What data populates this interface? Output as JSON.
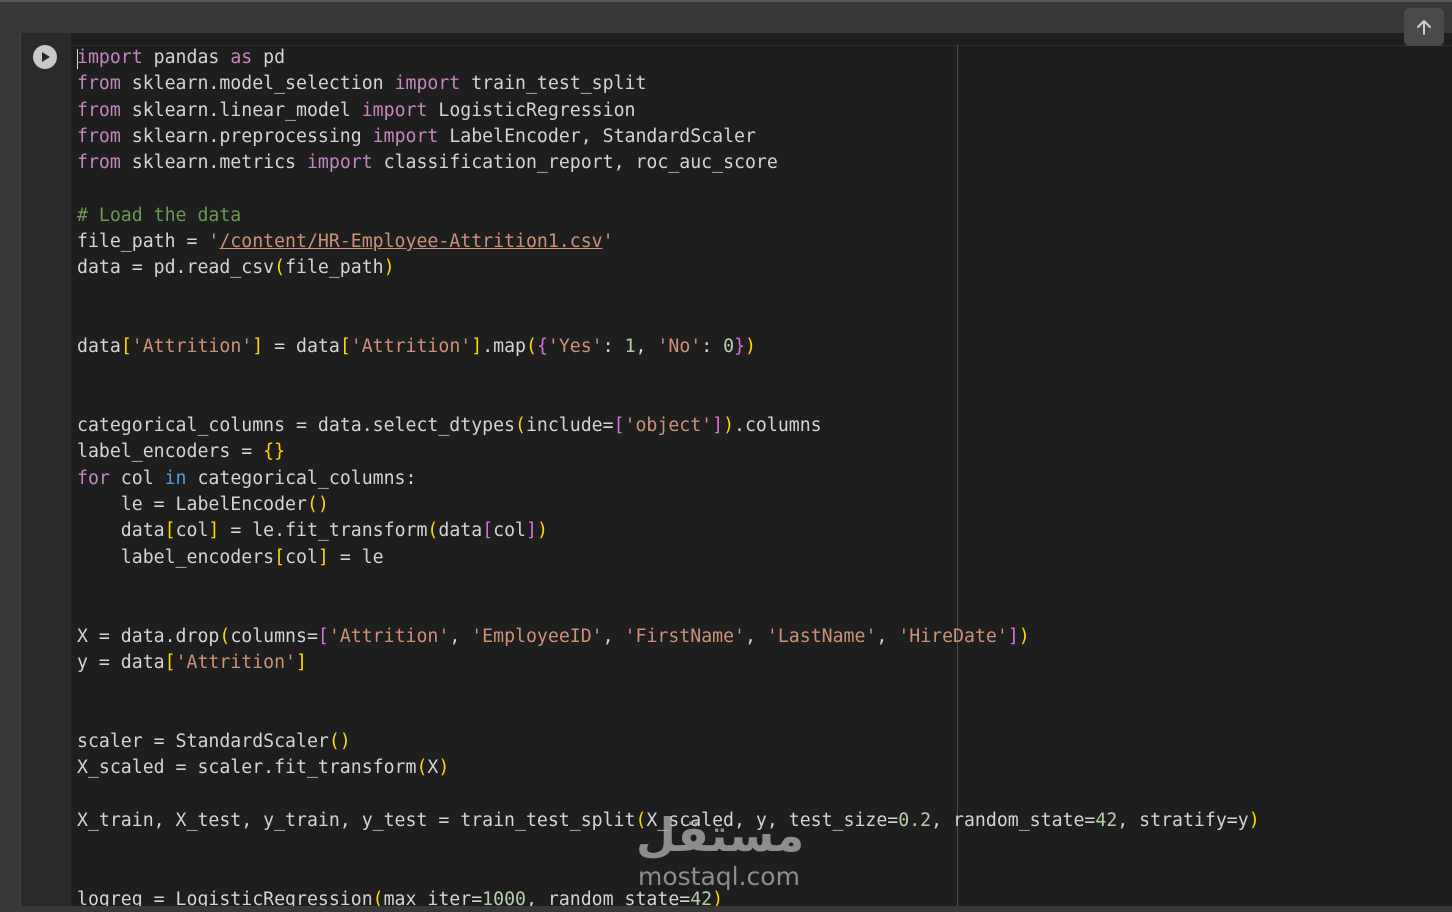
{
  "toolbar": {
    "scroll_up_icon": "arrow-up-icon"
  },
  "cell": {
    "run_icon": "play-icon",
    "lines": [
      [
        [
          "k",
          "import"
        ],
        [
          "t",
          " pandas "
        ],
        [
          "k",
          "as"
        ],
        [
          "t",
          " pd"
        ]
      ],
      [
        [
          "k",
          "from"
        ],
        [
          "t",
          " sklearn.model_selection "
        ],
        [
          "k",
          "import"
        ],
        [
          "t",
          " train_test_split"
        ]
      ],
      [
        [
          "k",
          "from"
        ],
        [
          "t",
          " sklearn.linear_model "
        ],
        [
          "k",
          "import"
        ],
        [
          "t",
          " LogisticRegression"
        ]
      ],
      [
        [
          "k",
          "from"
        ],
        [
          "t",
          " sklearn.preprocessing "
        ],
        [
          "k",
          "import"
        ],
        [
          "t",
          " LabelEncoder, StandardScaler"
        ]
      ],
      [
        [
          "k",
          "from"
        ],
        [
          "t",
          " sklearn.metrics "
        ],
        [
          "k",
          "import"
        ],
        [
          "t",
          " classification_report, roc_auc_score"
        ]
      ],
      [],
      [
        [
          "c",
          "# Load the data"
        ]
      ],
      [
        [
          "t",
          "file_path = "
        ],
        [
          "s",
          "'"
        ],
        [
          "su",
          "/content/HR-Employee-Attrition1.csv"
        ],
        [
          "s",
          "'"
        ]
      ],
      [
        [
          "t",
          "data = pd.read_csv"
        ],
        [
          "b1",
          "("
        ],
        [
          "t",
          "file_path"
        ],
        [
          "b1",
          ")"
        ]
      ],
      [],
      [],
      [
        [
          "t",
          "data"
        ],
        [
          "b1",
          "["
        ],
        [
          "s",
          "'Attrition'"
        ],
        [
          "b1",
          "]"
        ],
        [
          "t",
          " = data"
        ],
        [
          "b1",
          "["
        ],
        [
          "s",
          "'Attrition'"
        ],
        [
          "b1",
          "]"
        ],
        [
          "t",
          ".map"
        ],
        [
          "b1",
          "("
        ],
        [
          "b2",
          "{"
        ],
        [
          "s",
          "'Yes'"
        ],
        [
          "t",
          ": "
        ],
        [
          "n",
          "1"
        ],
        [
          "t",
          ", "
        ],
        [
          "s",
          "'No'"
        ],
        [
          "t",
          ": "
        ],
        [
          "n",
          "0"
        ],
        [
          "b2",
          "}"
        ],
        [
          "b1",
          ")"
        ]
      ],
      [],
      [],
      [
        [
          "t",
          "categorical_columns = data.select_dtypes"
        ],
        [
          "b1",
          "("
        ],
        [
          "t",
          "include="
        ],
        [
          "b2",
          "["
        ],
        [
          "s",
          "'object'"
        ],
        [
          "b2",
          "]"
        ],
        [
          "b1",
          ")"
        ],
        [
          "t",
          ".columns"
        ]
      ],
      [
        [
          "t",
          "label_encoders = "
        ],
        [
          "b1",
          "{}"
        ]
      ],
      [
        [
          "k",
          "for"
        ],
        [
          "t",
          " col "
        ],
        [
          "kw",
          "in"
        ],
        [
          "t",
          " categorical_columns:"
        ]
      ],
      [
        [
          "t",
          "    le = LabelEncoder"
        ],
        [
          "b1",
          "()"
        ]
      ],
      [
        [
          "t",
          "    data"
        ],
        [
          "b1",
          "["
        ],
        [
          "t",
          "col"
        ],
        [
          "b1",
          "]"
        ],
        [
          "t",
          " = le.fit_transform"
        ],
        [
          "b1",
          "("
        ],
        [
          "t",
          "data"
        ],
        [
          "b2",
          "["
        ],
        [
          "t",
          "col"
        ],
        [
          "b2",
          "]"
        ],
        [
          "b1",
          ")"
        ]
      ],
      [
        [
          "t",
          "    label_encoders"
        ],
        [
          "b1",
          "["
        ],
        [
          "t",
          "col"
        ],
        [
          "b1",
          "]"
        ],
        [
          "t",
          " = le"
        ]
      ],
      [],
      [],
      [
        [
          "t",
          "X = data.drop"
        ],
        [
          "b1",
          "("
        ],
        [
          "t",
          "columns="
        ],
        [
          "b2",
          "["
        ],
        [
          "s",
          "'Attrition'"
        ],
        [
          "t",
          ", "
        ],
        [
          "s",
          "'EmployeeID'"
        ],
        [
          "t",
          ", "
        ],
        [
          "s",
          "'FirstName'"
        ],
        [
          "t",
          ", "
        ],
        [
          "s",
          "'LastName'"
        ],
        [
          "t",
          ", "
        ],
        [
          "s",
          "'HireDate'"
        ],
        [
          "b2",
          "]"
        ],
        [
          "b1",
          ")"
        ]
      ],
      [
        [
          "t",
          "y = data"
        ],
        [
          "b1",
          "["
        ],
        [
          "s",
          "'Attrition'"
        ],
        [
          "b1",
          "]"
        ]
      ],
      [],
      [],
      [
        [
          "t",
          "scaler = StandardScaler"
        ],
        [
          "b1",
          "()"
        ]
      ],
      [
        [
          "t",
          "X_scaled = scaler.fit_transform"
        ],
        [
          "b1",
          "("
        ],
        [
          "t",
          "X"
        ],
        [
          "b1",
          ")"
        ]
      ],
      [],
      [
        [
          "t",
          "X_train, X_test, y_train, y_test = train_test_split"
        ],
        [
          "b1",
          "("
        ],
        [
          "t",
          "X_scaled, y, test_size="
        ],
        [
          "n",
          "0.2"
        ],
        [
          "t",
          ", random_state="
        ],
        [
          "n",
          "42"
        ],
        [
          "t",
          ", stratify=y"
        ],
        [
          "b1",
          ")"
        ]
      ],
      [],
      [],
      [
        [
          "t",
          "logreg = LogisticRegression"
        ],
        [
          "b1",
          "("
        ],
        [
          "t",
          "max_iter="
        ],
        [
          "n",
          "1000"
        ],
        [
          "t",
          ", random_state="
        ],
        [
          "n",
          "42"
        ],
        [
          "b1",
          ")"
        ]
      ]
    ]
  },
  "watermark": {
    "arabic": "مستقل",
    "latin": "mostaql.com"
  }
}
